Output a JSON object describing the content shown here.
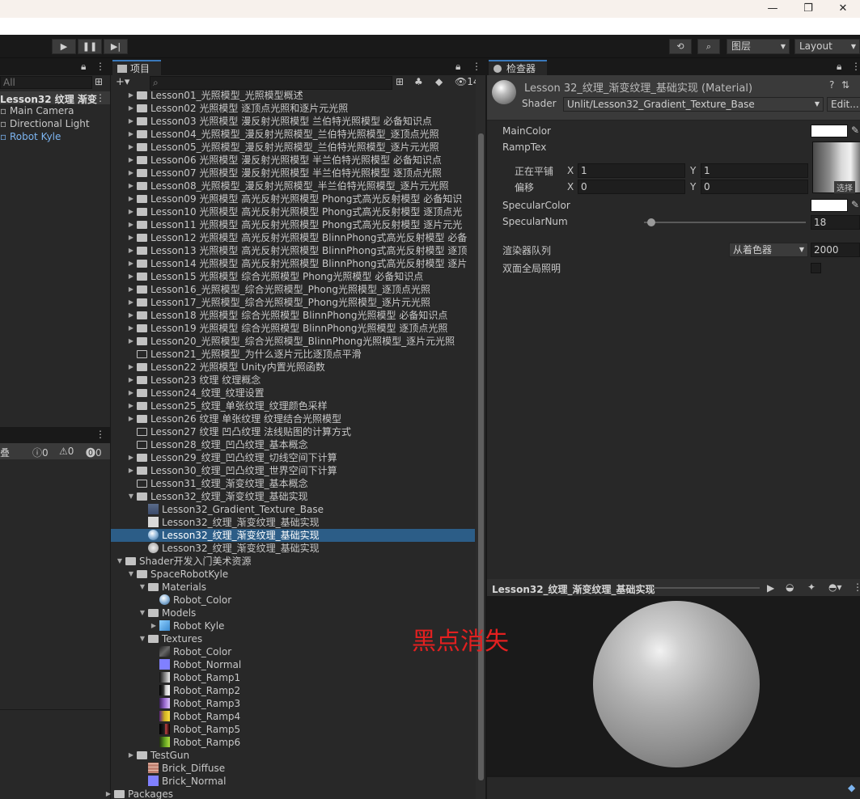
{
  "window": {
    "minimize": "—",
    "maximize": "❐",
    "close": "✕"
  },
  "toolbar": {
    "play": "▶",
    "pause": "❚❚",
    "step": "▶|",
    "history": "⟲",
    "search": "⌕",
    "layers": "图层",
    "layout": "Layout"
  },
  "hierarchy": {
    "scene": "Lesson32 纹理 渐变",
    "search_placeholder": "All",
    "items": [
      "Main Camera",
      "Directional Light",
      "Robot Kyle"
    ]
  },
  "console": {
    "clear_label": "叠",
    "counts": [
      "0",
      "0",
      "0"
    ]
  },
  "project": {
    "tab": "项目",
    "add": "+▾",
    "hidden_count": "14",
    "rows": [
      {
        "label": "Lesson01_光照模型_光照模型概述",
        "kind": "folder"
      },
      {
        "label": "Lesson02 光照模型 逐顶点光照和逐片元光照",
        "kind": "folder"
      },
      {
        "label": "Lesson03 光照模型 漫反射光照模型 兰伯特光照模型 必备知识点",
        "kind": "folder"
      },
      {
        "label": "Lesson04_光照模型_漫反射光照模型_兰伯特光照模型_逐顶点光照",
        "kind": "folder"
      },
      {
        "label": "Lesson05_光照模型_漫反射光照模型_兰伯特光照模型_逐片元光照",
        "kind": "folder"
      },
      {
        "label": "Lesson06 光照模型 漫反射光照模型 半兰伯特光照模型 必备知识点",
        "kind": "folder"
      },
      {
        "label": "Lesson07 光照模型 漫反射光照模型 半兰伯特光照模型 逐顶点光照",
        "kind": "folder"
      },
      {
        "label": "Lesson08_光照模型_漫反射光照模型_半兰伯特光照模型_逐片元光照",
        "kind": "folder"
      },
      {
        "label": "Lesson09 光照模型 高光反射光照模型 Phong式高光反射模型 必备知识",
        "kind": "folder"
      },
      {
        "label": "Lesson10 光照模型 高光反射光照模型 Phong式高光反射模型 逐顶点光",
        "kind": "folder"
      },
      {
        "label": "Lesson11 光照模型 高光反射光照模型 Phong式高光反射模型 逐片元光",
        "kind": "folder"
      },
      {
        "label": "Lesson12 光照模型 高光反射光照模型 BlinnPhong式高光反射模型 必备",
        "kind": "folder"
      },
      {
        "label": "Lesson13 光照模型 高光反射光照模型 BlinnPhong式高光反射模型 逐顶",
        "kind": "folder"
      },
      {
        "label": "Lesson14 光照模型 高光反射光照模型 BlinnPhong式高光反射模型 逐片",
        "kind": "folder"
      },
      {
        "label": "Lesson15 光照模型 综合光照模型 Phong光照模型 必备知识点",
        "kind": "folder"
      },
      {
        "label": "Lesson16_光照模型_综合光照模型_Phong光照模型_逐顶点光照",
        "kind": "folder"
      },
      {
        "label": "Lesson17_光照模型_综合光照模型_Phong光照模型_逐片元光照",
        "kind": "folder"
      },
      {
        "label": "Lesson18 光照模型 综合光照模型 BlinnPhong光照模型 必备知识点",
        "kind": "folder"
      },
      {
        "label": "Lesson19 光照模型 综合光照模型 BlinnPhong光照模型 逐顶点光照",
        "kind": "folder"
      },
      {
        "label": "Lesson20_光照模型_综合光照模型_BlinnPhong光照模型_逐片元光照",
        "kind": "folder"
      },
      {
        "label": "Lesson21_光照模型_为什么逐片元比逐顶点平滑",
        "kind": "empty"
      },
      {
        "label": "Lesson22 光照模型 Unity内置光照函数",
        "kind": "folder"
      },
      {
        "label": "Lesson23 纹理 纹理概念",
        "kind": "folder"
      },
      {
        "label": "Lesson24_纹理_纹理设置",
        "kind": "folder"
      },
      {
        "label": "Lesson25_纹理_单张纹理_纹理颜色采样",
        "kind": "folder"
      },
      {
        "label": "Lesson26 纹理 单张纹理 纹理结合光照模型",
        "kind": "folder"
      },
      {
        "label": "Lesson27 纹理 凹凸纹理 法线贴图的计算方式",
        "kind": "empty"
      },
      {
        "label": "Lesson28_纹理_凹凸纹理_基本概念",
        "kind": "empty"
      },
      {
        "label": "Lesson29_纹理_凹凸纹理_切线空间下计算",
        "kind": "folder"
      },
      {
        "label": "Lesson30_纹理_凹凸纹理_世界空间下计算",
        "kind": "folder"
      },
      {
        "label": "Lesson31_纹理_渐变纹理_基本概念",
        "kind": "empty"
      },
      {
        "label": "Lesson32_纹理_渐变纹理_基础实现",
        "kind": "open"
      },
      {
        "label": "Lesson32_Gradient_Texture_Base",
        "kind": "shader"
      },
      {
        "label": "Lesson32_纹理_渐变纹理_基础实现",
        "kind": "script"
      },
      {
        "label": "Lesson32_纹理_渐变纹理_基础实现",
        "kind": "material"
      },
      {
        "label": "Lesson32_纹理_渐变纹理_基础实现",
        "kind": "scene"
      },
      {
        "label": "Shader开发入门美术资源",
        "kind": "open"
      },
      {
        "label": "SpaceRobotKyle",
        "kind": "open"
      },
      {
        "label": "Materials",
        "kind": "open"
      },
      {
        "label": "Robot_Color",
        "kind": "material"
      },
      {
        "label": "Models",
        "kind": "open"
      },
      {
        "label": "Robot Kyle",
        "kind": "model"
      },
      {
        "label": "Textures",
        "kind": "open"
      },
      {
        "label": "Robot_Color",
        "kind": "tex-color"
      },
      {
        "label": "Robot_Normal",
        "kind": "tex-normal"
      },
      {
        "label": "Robot_Ramp1",
        "kind": "ramp1"
      },
      {
        "label": "Robot_Ramp2",
        "kind": "ramp2"
      },
      {
        "label": "Robot_Ramp3",
        "kind": "ramp3"
      },
      {
        "label": "Robot_Ramp4",
        "kind": "ramp4"
      },
      {
        "label": "Robot_Ramp5",
        "kind": "ramp5"
      },
      {
        "label": "Robot_Ramp6",
        "kind": "ramp6"
      },
      {
        "label": "TestGun",
        "kind": "folder"
      },
      {
        "label": "Brick_Diffuse",
        "kind": "brick"
      },
      {
        "label": "Brick_Normal",
        "kind": "tex-normal"
      },
      {
        "label": "Packages",
        "kind": "folder"
      }
    ]
  },
  "inspector": {
    "tab": "检查器",
    "title": "Lesson 32_纹理_渐变纹理_基础实现 (Material)",
    "shader_label": "Shader",
    "shader_value": "Unlit/Lesson32_Gradient_Texture_Base",
    "edit_button": "Edit...",
    "main_color": "MainColor",
    "ramp_tex": "RampTex",
    "tiling": "正在平铺",
    "offset": "偏移",
    "x": "X",
    "y": "Y",
    "tiling_x": "1",
    "tiling_y": "1",
    "offset_x": "0",
    "offset_y": "0",
    "select": "选择",
    "specular_color": "SpecularColor",
    "specular_num": "SpecularNum",
    "specular_value": "18",
    "specular_fraction": 0.02,
    "render_queue": "渲染器队列",
    "render_queue_mode": "从着色器",
    "render_queue_value": "2000",
    "double_sided_gi": "双面全局照明"
  },
  "preview": {
    "title": "Lesson32_纹理_渐变纹理_基础实现"
  },
  "annotation": "黑点消失",
  "colors": {
    "selection": "#2c5d87",
    "tab_accent": "#3a79bb",
    "annotation": "#e22020"
  }
}
